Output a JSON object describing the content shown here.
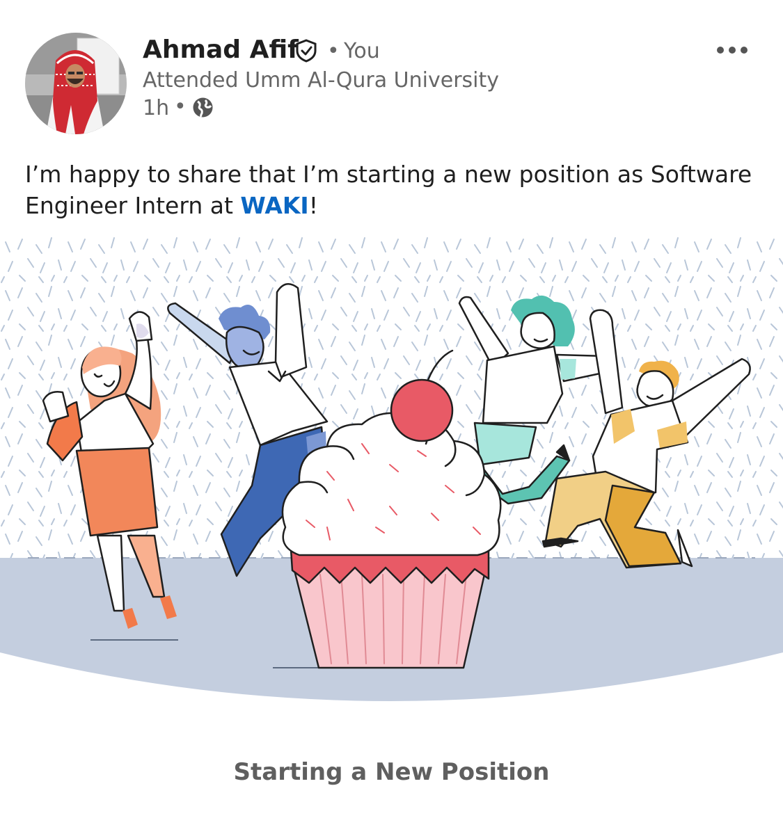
{
  "author": {
    "name": "Ahmad Afif",
    "you_label": "You",
    "separator": "•",
    "headline": "Attended Umm Al-Qura University",
    "time": "1h",
    "visibility_icon": "globe-icon",
    "badge_icon": "verified-shield-icon"
  },
  "post": {
    "text_before": "I’m happy to share that I’m starting a new position as Software Engineer Intern at ",
    "mention": "WAKI",
    "text_after": "!"
  },
  "card": {
    "caption": "Starting a New Position",
    "illustration": "celebration-cupcake-illustration"
  },
  "menu": {
    "icon": "more-horizontal-icon"
  },
  "colors": {
    "link": "#0a66c2",
    "primary_text": "#1f1f1f",
    "secondary_text": "#666666",
    "floor": "#c4cedf",
    "cherry": "#e85a66",
    "frosting_band": "#e85a66",
    "cup": "#f9c6cc"
  }
}
